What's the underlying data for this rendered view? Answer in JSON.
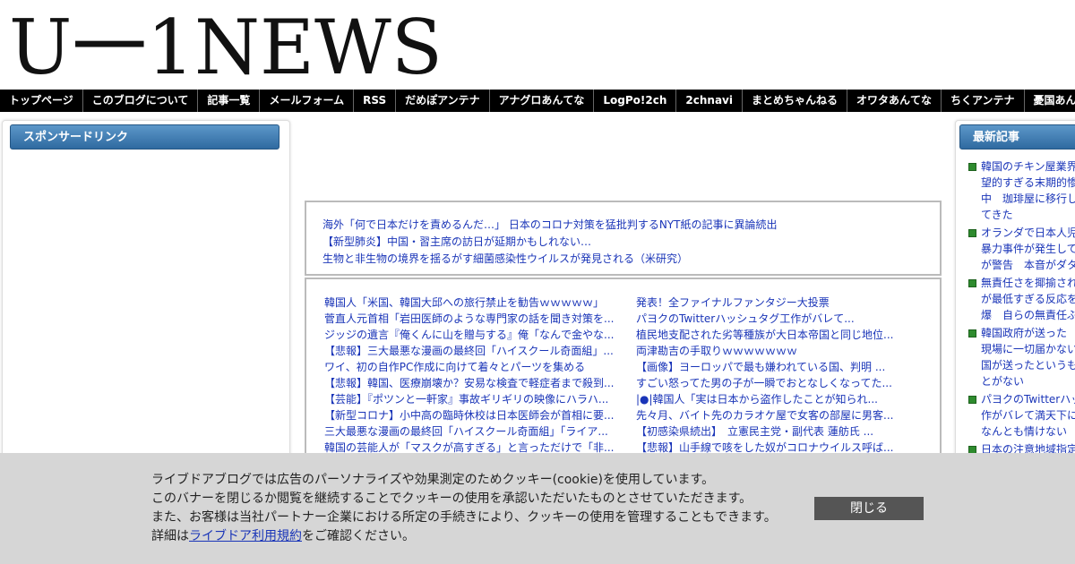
{
  "site": {
    "logo_text": "U一1NEWS"
  },
  "nav": {
    "items": [
      "トップページ",
      "このブログについて",
      "記事一覧",
      "メールフォーム",
      "RSS",
      "だめぽアンテナ",
      "アナグロあんてな",
      "LogPo!2ch",
      "2chnavi",
      "まとめちゃんねる",
      "オワタあんてな",
      "ちくアンテナ",
      "憂国あんてな"
    ]
  },
  "left_panel": {
    "header": "スポンサードリンク"
  },
  "right_panel": {
    "header": "最新記事",
    "items": [
      [
        "韓国のチキン屋業界",
        "望的すぎる末期的惨",
        "中　珈琲屋に移行し",
        "てきた"
      ],
      [
        "オランダで日本人児",
        "暴力事件が発生して",
        "が警告　本音がダタ"
      ],
      [
        "無責任さを揶揄され",
        "が最低すぎる反応を",
        "爆　自らの無責任ぶ"
      ],
      [
        "韓国政府が送った",
        "現場に一切届かない",
        "国が送ったというも",
        "とがない"
      ],
      [
        "パヨクのTwitterハッ",
        "作がバレて満天下に",
        "なんとも情けない"
      ],
      [
        "日本の注意地域指定"
      ]
    ]
  },
  "top_box": {
    "links": [
      "海外「何で日本だけを責めるんだ…」 日本のコロナ対策を猛批判するNYT紙の記事に異論続出",
      "【新型肺炎】中国・習主席の訪日が延期かもしれない…",
      "生物と非生物の境界を揺るがす細菌感染性ウイルスが発見される（米研究）"
    ]
  },
  "links_box": {
    "left": [
      "韓国人「米国、韓国大邱への旅行禁止を勧告ｗｗｗｗｗ」",
      "菅直人元首相「岩田医師のような専門家の話を聞き対策を...",
      "ジッジの遺言『俺くんに山を贈与する』俺「なんで金やな...",
      "【悲報】三大最悪な漫画の最終回「ハイスクール奇面組」...",
      "ワイ、初の自作PC作成に向けて着々とパーツを集める",
      "【悲報】韓国、医療崩壊か？安易な検査で軽症者まで殺到...",
      "【芸能】『ポツンと一軒家』事故ギリギリの映像にハラハ...",
      "【新型コロナ】小中高の臨時休校は日本医師会が首相に要...",
      "三大最悪な漫画の最終回「ハイスクール奇面組」「ライア...",
      "韓国の芸能人が「マスクが高すぎる」と言っただけで「非..."
    ],
    "right": [
      "発表！全ファイナルファンタジー大投票",
      "パヨクのTwitterハッシュタグ工作がバレて...",
      "植民地支配された劣等種族が大日本帝国と同じ地位...",
      "両津勘吉の手取りｗｗｗｗｗｗｗ",
      "【画像】ヨーロッパで最も嫌われている国、判明 ...",
      "すごい怒ってた男の子が一瞬でおとなしくなってた...",
      "|●|韓国人「実は日本から盗作したことが知られ...",
      "先々月、バイト先のカラオケ屋で女客の部屋に男客...",
      "【初感染県続出】　立憲民主党・副代表 蓮舫氏 ...",
      "【悲報】山手線で咳をした奴がコロナウイルス呼ば..."
    ]
  },
  "cookie": {
    "line1": "ライブドアブログでは広告のパーソナライズや効果測定のためクッキー(cookie)を使用しています。",
    "line2": "このバナーを閉じるか閲覧を継続することでクッキーの使用を承認いただいたものとさせていただきます。",
    "line3": "また、お客様は当社パートナー企業における所定の手続きにより、クッキーの使用を管理することもできます。",
    "line4_prefix": "詳細は",
    "line4_link": "ライブドア利用規約",
    "line4_suffix": "をご確認ください。",
    "close_label": "閉じる"
  },
  "colors": {
    "link": "#1a35b8",
    "nav_bg": "#000000",
    "panel_header": "#2f6aa0",
    "bullet": "#2e8b2e",
    "cookie_bg": "#d6d6d6",
    "close_btn": "#555555"
  }
}
